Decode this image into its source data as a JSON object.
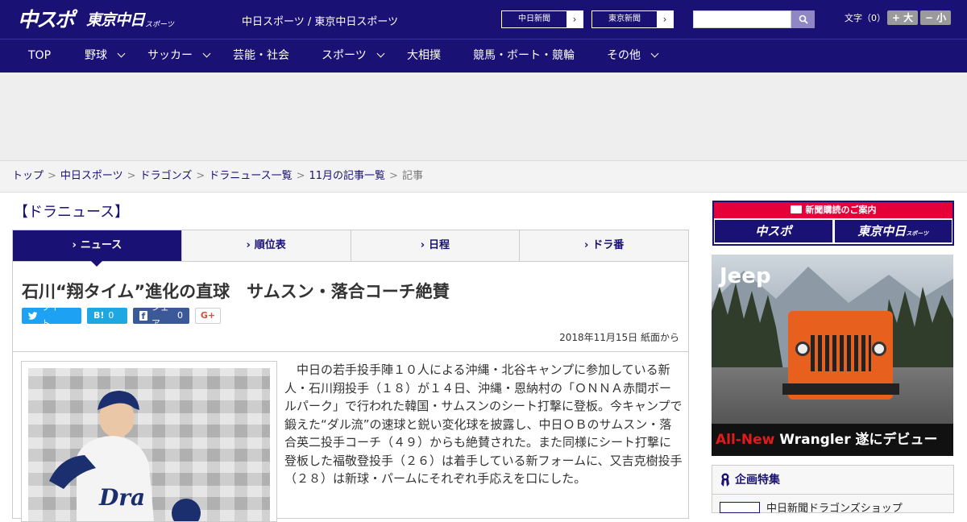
{
  "header": {
    "logo_main": "中スポ",
    "logo_sub": "東京中日",
    "logo_subsmall": "スポーツ",
    "site_name": "中日スポーツ / 東京中日スポーツ",
    "paper_links": [
      {
        "label": "中日新聞"
      },
      {
        "label": "東京新聞"
      }
    ],
    "search_placeholder": "",
    "fontsize_label": "文字（0）",
    "fontsize_up": "+ 大",
    "fontsize_down": "− 小"
  },
  "nav": {
    "items": [
      {
        "label": "TOP",
        "has_dropdown": false
      },
      {
        "label": "野球",
        "has_dropdown": true
      },
      {
        "label": "サッカー",
        "has_dropdown": true
      },
      {
        "label": "芸能・社会",
        "has_dropdown": false
      },
      {
        "label": "スポーツ",
        "has_dropdown": true
      },
      {
        "label": "大相撲",
        "has_dropdown": false
      },
      {
        "label": "競馬・ボート・競輪",
        "has_dropdown": false
      },
      {
        "label": "その他",
        "has_dropdown": true
      }
    ]
  },
  "breadcrumb": {
    "items": [
      "トップ",
      "中日スポーツ",
      "ドラゴンズ",
      "ドラニュース一覧",
      "11月の記事一覧"
    ],
    "separator": ">",
    "current": "記事"
  },
  "section": {
    "title": "【ドラニュース】"
  },
  "tabs": [
    {
      "label": "ニュース",
      "active": true
    },
    {
      "label": "順位表",
      "active": false
    },
    {
      "label": "日程",
      "active": false
    },
    {
      "label": "ドラ番",
      "active": false
    }
  ],
  "article": {
    "headline": "石川“翔タイム”進化の直球　サムスン・落合コーチ絶賛",
    "share": {
      "tweet_label": "ツイート",
      "hatena_label": "B!",
      "hatena_count": "0",
      "facebook_label": "シェア",
      "facebook_count": "0",
      "gplus_label": "G+"
    },
    "dateline": "2018年11月15日 紙面から",
    "body": "中日の若手投手陣１０人による沖縄・北谷キャンプに参加している新人・石川翔投手（１８）が１４日、沖縄・恩納村の「ＯＮＮＡ赤間ボールパーク」で行われた韓国・サムスンのシート打撃に登板。今キャンプで鍛えた“ダル流”の速球と鋭い変化球を披露し、中日ＯＢのサムスン・落合英二投手コーチ（４９）からも絶賛された。また同様にシート打撃に登板した福敬登投手（２６）は着手している新フォームに、又吉克樹投手（２８）は新球・パームにそれぞれ手応えを口にした。"
  },
  "sidebar": {
    "subscribe_head": "新聞購読のご案内",
    "subscribe_logo_1": "中スポ",
    "subscribe_logo_2": "東京中日",
    "subscribe_logo_2_small": "スポーツ",
    "ad": {
      "brand": "Jeep",
      "caption_red": "All-New",
      "caption_white": " Wrangler 遂にデビュー"
    },
    "feature": {
      "title": "企画特集",
      "item_label": "中日新聞ドラゴンズショップ"
    }
  },
  "colors": {
    "brand_navy": "#1a1174",
    "accent_red": "#e6003a",
    "twitter": "#1da1f2",
    "hatena": "#1ea7e1",
    "facebook": "#3b5998"
  }
}
